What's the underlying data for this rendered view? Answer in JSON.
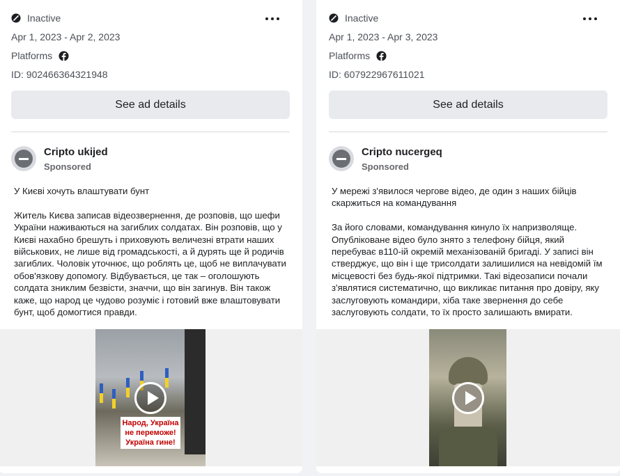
{
  "cards": [
    {
      "status": "Inactive",
      "dates": "Apr 1, 2023 - Apr 2, 2023",
      "platforms_label": "Platforms",
      "id_text": "ID: 902466364321948",
      "details_label": "See ad details",
      "page_name": "Cripto ukijed",
      "sponsored": "Sponsored",
      "body": "У Києві хочуть влаштувати бунт\n\nЖитель Києва записав відеозвернення, де розповів, що шефи України наживаються на загиблих солдатах. Він розповів, що у Києві нахабно брешуть і приховують величезні втрати наших військових, не лише від громадськості, а й дурять ще й родичів загиблих. Чоловік уточнює, що роблять це, щоб не виплачувати обов'язкову допомогу. Відбувається, це так – оголошують солдата зниклим безвісти, значчи, що він загинув. Він також каже, що народ це чудово розуміє і готовий вже влаштовувати бунт, щоб домогтися правди.",
      "video_overlay": "Народ, Україна\nне переможе!\nУкраїна гине!"
    },
    {
      "status": "Inactive",
      "dates": "Apr 1, 2023 - Apr 3, 2023",
      "platforms_label": "Platforms",
      "id_text": "ID: 607922967611021",
      "details_label": "See ad details",
      "page_name": "Cripto nucergeq",
      "sponsored": "Sponsored",
      "body": "У мережі з'явилося чергове відео, де один з наших бійців скаржиться на командування\n\nЗа його словами, командування кинуло їх напризволяще. Опубліковане відео було знято з телефону бійця, який перебуває в110-ій окремій механізованій бригаді. У записі він стверджує, що він і ще трисолдати залишилися на невідомій їм місцевості без будь-якої підтримки. Такі відеозаписи почали з'являтися систематично, що викликає питання про довіру, яку заслуговують командири, хіба таке звернення до себе заслуговують солдати, то їх просто залишають вмирати."
    }
  ],
  "icons": {
    "status": "inactive-circle-slash-icon",
    "more": "more-options-ellipsis-icon",
    "platform": "facebook-icon",
    "avatar": "blocked-page-avatar-icon",
    "play": "play-icon"
  },
  "colors": {
    "page_bg": "#f0f2f5",
    "card_bg": "#ffffff",
    "button_bg": "#e9eaed",
    "overlay_text": "#c00000"
  }
}
